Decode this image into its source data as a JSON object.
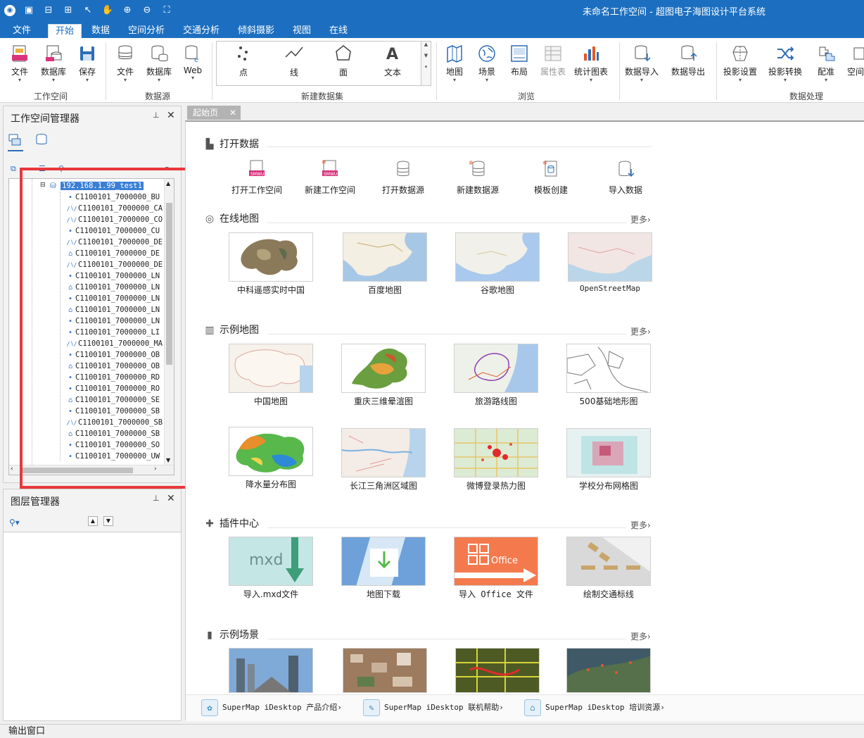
{
  "window": {
    "title": "未命名工作空间 - 超图电子海图设计平台系统"
  },
  "menu": [
    "文件",
    "开始",
    "数据",
    "空间分析",
    "交通分析",
    "倾斜摄影",
    "视图",
    "在线"
  ],
  "ribbon": {
    "workspace": {
      "items": [
        "文件",
        "数据库",
        "保存"
      ],
      "label": "工作空间"
    },
    "datasource": {
      "items": [
        "文件",
        "数据库",
        "Web"
      ],
      "label": "数据源"
    },
    "new_dataset": {
      "items": [
        "点",
        "线",
        "面",
        "文本"
      ],
      "label": "新建数据集"
    },
    "browse": {
      "items": [
        "地图",
        "场景",
        "布局",
        "属性表",
        "统计图表"
      ],
      "label": "浏览"
    },
    "data_processing": {
      "items": [
        "数据导入",
        "数据导出",
        "投影设置",
        "投影转换",
        "配准",
        "空间"
      ],
      "label": "数据处理"
    }
  },
  "workspace_manager": {
    "title": "工作空间管理器",
    "root_node": "192.168.1.99_test1",
    "nodes": [
      {
        "icon": "point",
        "label": "C1100101_7000000_BU"
      },
      {
        "icon": "line",
        "label": "C1100101_7000000_CA"
      },
      {
        "icon": "line",
        "label": "C1100101_7000000_CO"
      },
      {
        "icon": "point",
        "label": "C1100101_7000000_CU"
      },
      {
        "icon": "line",
        "label": "C1100101_7000000_DE"
      },
      {
        "icon": "region",
        "label": "C1100101_7000000_DE"
      },
      {
        "icon": "line",
        "label": "C1100101_7000000_DE"
      },
      {
        "icon": "point",
        "label": "C1100101_7000000_LN"
      },
      {
        "icon": "region",
        "label": "C1100101_7000000_LN"
      },
      {
        "icon": "point",
        "label": "C1100101_7000000_LN"
      },
      {
        "icon": "region",
        "label": "C1100101_7000000_LN"
      },
      {
        "icon": "point",
        "label": "C1100101_7000000_LN"
      },
      {
        "icon": "point",
        "label": "C1100101_7000000_LI"
      },
      {
        "icon": "line",
        "label": "C1100101_7000000_MA"
      },
      {
        "icon": "point",
        "label": "C1100101_7000000_OB"
      },
      {
        "icon": "region",
        "label": "C1100101_7000000_OB"
      },
      {
        "icon": "point",
        "label": "C1100101_7000000_RD"
      },
      {
        "icon": "point",
        "label": "C1100101_7000000_RO"
      },
      {
        "icon": "region",
        "label": "C1100101_7000000_SE"
      },
      {
        "icon": "point",
        "label": "C1100101_7000000_SB"
      },
      {
        "icon": "line",
        "label": "C1100101_7000000_SB"
      },
      {
        "icon": "region",
        "label": "C1100101_7000000_SB"
      },
      {
        "icon": "point",
        "label": "C1100101_7000000_SO"
      },
      {
        "icon": "point",
        "label": "C1100101_7000000_UW"
      }
    ]
  },
  "layer_manager": {
    "title": "图层管理器"
  },
  "doc_tab": {
    "label": "起始页"
  },
  "start_page": {
    "open_data": {
      "title": "打开数据",
      "items": [
        "打开工作空间",
        "新建工作空间",
        "打开数据源",
        "新建数据源",
        "模板创建",
        "导入数据"
      ]
    },
    "online_maps": {
      "title": "在线地图",
      "more": "更多›",
      "items": [
        "中科遥感实时中国",
        "百度地图",
        "谷歌地图",
        "OpenStreetMap"
      ]
    },
    "sample_maps": {
      "title": "示例地图",
      "more": "更多›",
      "row1": [
        "中国地图",
        "重庆三维晕渲图",
        "旅游路线图",
        "500基础地形图"
      ],
      "row2": [
        "降水量分布图",
        "长江三角洲区域图",
        "微博登录热力图",
        "学校分布网格图"
      ]
    },
    "plugins": {
      "title": "插件中心",
      "more": "更多›",
      "items": [
        "导入.mxd文件",
        "地图下载",
        "导入 Office 文件",
        "绘制交通标线"
      ],
      "mxd_text": "mxd",
      "office_text": "Office"
    },
    "sample_scenes": {
      "title": "示例场景",
      "more": "更多›"
    },
    "footer": [
      "SuperMap iDesktop 产品介绍›",
      "SuperMap iDesktop 联机帮助›",
      "SuperMap iDesktop 培训资源›"
    ]
  },
  "status_bar": {
    "label": "输出窗口"
  }
}
